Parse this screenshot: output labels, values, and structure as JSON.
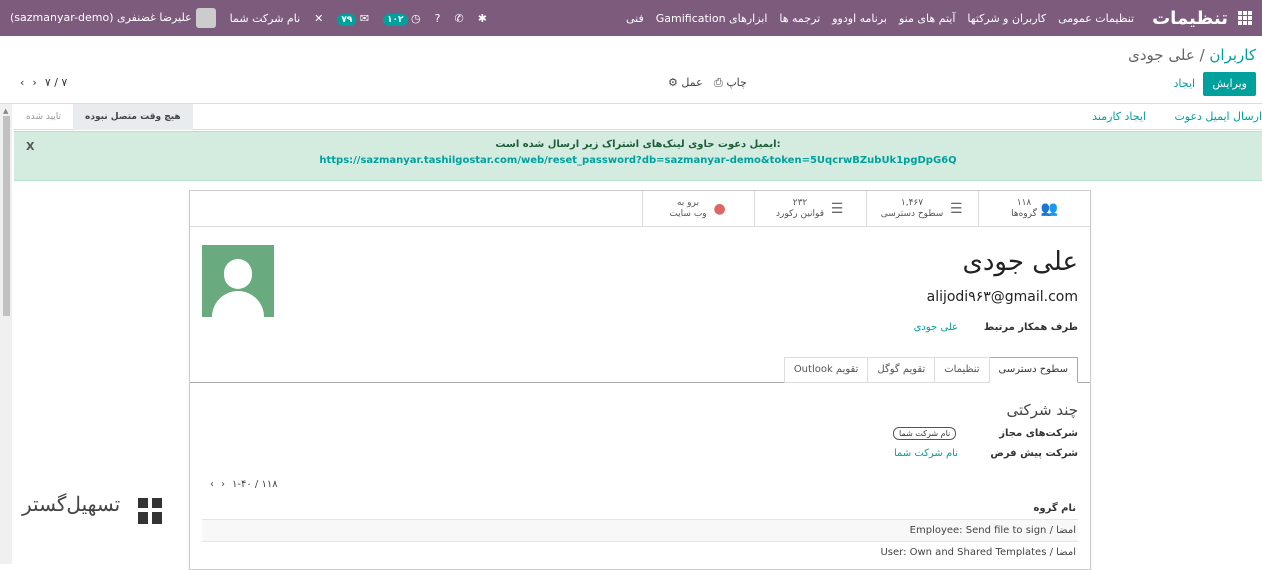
{
  "navbar": {
    "brand": "تنظیمات",
    "menu": [
      "تنظیمات عمومی",
      "کاربران و شرکتها",
      "آیتم های منو",
      "برنامه اودوو",
      "ترجمه ها",
      "ابزارهای Gamification",
      "فنی"
    ],
    "systray": {
      "activity_count": "۷۹",
      "clock_count": "۱۰۲",
      "company": "نام شرکت شما",
      "user": "علیرضا غضنفری (sazmanyar-demo)"
    }
  },
  "breadcrumb": {
    "parent": "کاربران",
    "separator": "/",
    "current": "علی جودی"
  },
  "buttons": {
    "edit": "ویرایش",
    "create": "ایجاد",
    "print": "چاپ",
    "action": "عمل"
  },
  "pager": {
    "value": "۷ / ۷"
  },
  "statusbar": {
    "send_invite": "ارسال ایمیل دعوت",
    "create_employee": "ایجاد کارمند",
    "stages": [
      "هیچ وقت متصل نبوده",
      "تایید شده"
    ]
  },
  "alert": {
    "message": "ایمیل دعوت حاوی لینک‌های اشتراک زیر ارسال شده است:",
    "link": "https://sazmanyar.tashilgostar.com/web/reset_password?db=sazmanyar-demo&token=5UqcrwBZubUk1pgDpG6Q",
    "close": "X"
  },
  "smart_buttons": [
    {
      "value": "۱۱۸",
      "label": "گروه‌ها",
      "icon": "users-icon"
    },
    {
      "value": "۱,۴۶۷",
      "label": "سطوح دسترسی",
      "icon": "list-icon"
    },
    {
      "value": "۲۳۲",
      "label": "قوانین رکورد",
      "icon": "list-icon"
    },
    {
      "value": "برو به",
      "label": "وب سایت",
      "icon": "globe-icon"
    }
  ],
  "user": {
    "name": "علی جودی",
    "email": "alijodi۹۶۳@gmail.com",
    "partner_label": "طرف همکار مرتبط",
    "partner_value": "علی جودی"
  },
  "tabs": [
    "سطوح دسترسی",
    "تنظیمات",
    "تقویم گوگل",
    "تقویم Outlook"
  ],
  "multi_company": {
    "title": "چند شرکتی",
    "allowed_label": "شرکت‌های مجاز",
    "allowed_value": "نام شرکت شما",
    "default_label": "شرکت پیش فرض",
    "default_value": "نام شرکت شما"
  },
  "groups": {
    "pager": "۱-۴۰ / ۱۱۸",
    "header": "نام گروه",
    "rows": [
      "امضا / Employee: Send file to sign",
      "امضا / User: Own and Shared Templates"
    ]
  },
  "watermark": "تسهیل‌گستر"
}
